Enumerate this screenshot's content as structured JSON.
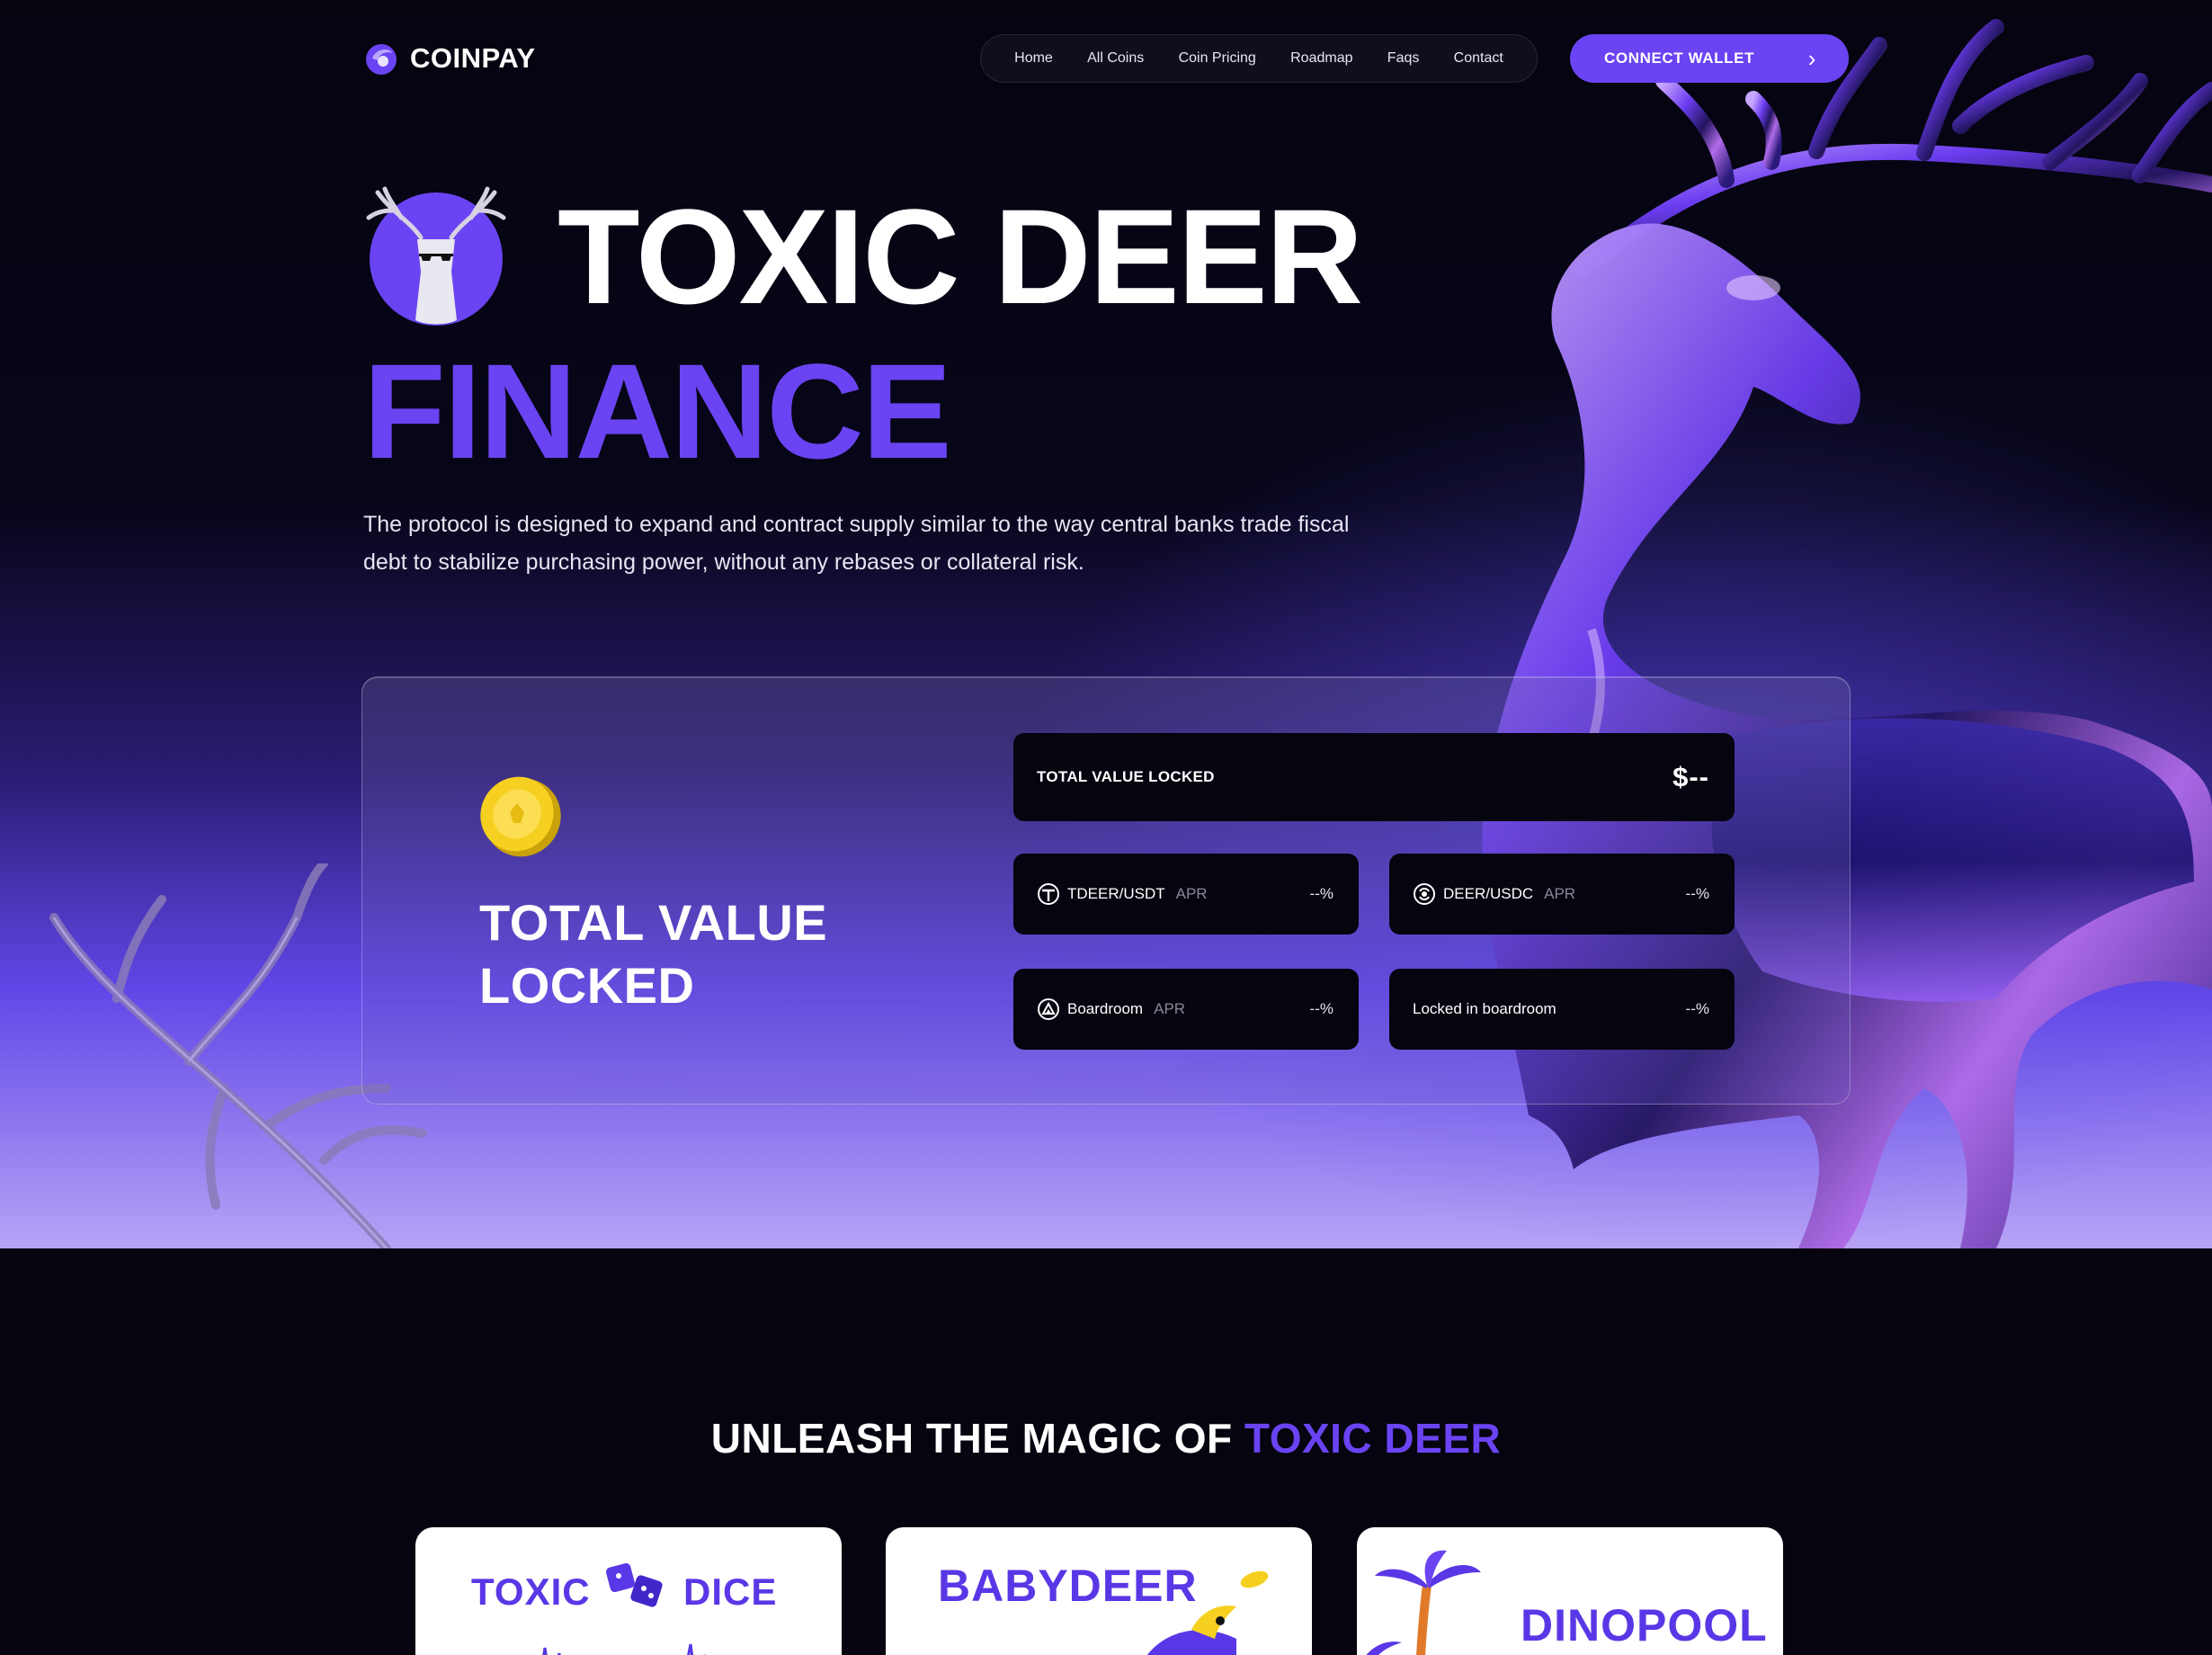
{
  "header": {
    "brand": "COINPAY",
    "nav": [
      "Home",
      "All Coins",
      "Coin Pricing",
      "Roadmap",
      "Faqs",
      "Contact"
    ],
    "cta_label": "CONNECT WALLET",
    "cta_icon": "chevron-right-icon"
  },
  "hero": {
    "title_line1": "TOXIC DEER",
    "title_line2": "FINANCE",
    "description": "The protocol is designed to expand and contract supply similar to the way central banks trade fiscal debt to stabilize purchasing power, without any rebases or collateral risk."
  },
  "tvl": {
    "heading_line1": "TOTAL VALUE",
    "heading_line2": "LOCKED",
    "main_label": "TOTAL VALUE LOCKED",
    "main_value": "$--",
    "tiles": [
      {
        "label": "TDEER/USDT",
        "apr": "APR",
        "value": "--%",
        "icon": "tdeer-token-icon"
      },
      {
        "label": "DEER/USDC",
        "apr": "APR",
        "value": "--%",
        "icon": "deer-usdc-token-icon"
      },
      {
        "label": "Boardroom",
        "apr": "APR",
        "value": "--%",
        "icon": "boardroom-icon"
      },
      {
        "label": "Locked in boardroom",
        "apr": "",
        "value": "--%",
        "icon": ""
      }
    ]
  },
  "section2": {
    "title_main": "UNLEASH THE MAGIC OF ",
    "title_highlight": "TOXIC DEER",
    "cards": [
      {
        "title_a": "TOXIC",
        "title_b": "DICE"
      },
      {
        "title": "BABYDEER"
      },
      {
        "title": "DINOPOOL"
      }
    ]
  },
  "colors": {
    "accent": "#6a44f2",
    "background": "#05040f",
    "tile": "#05040f",
    "coin": "#f5d020"
  }
}
